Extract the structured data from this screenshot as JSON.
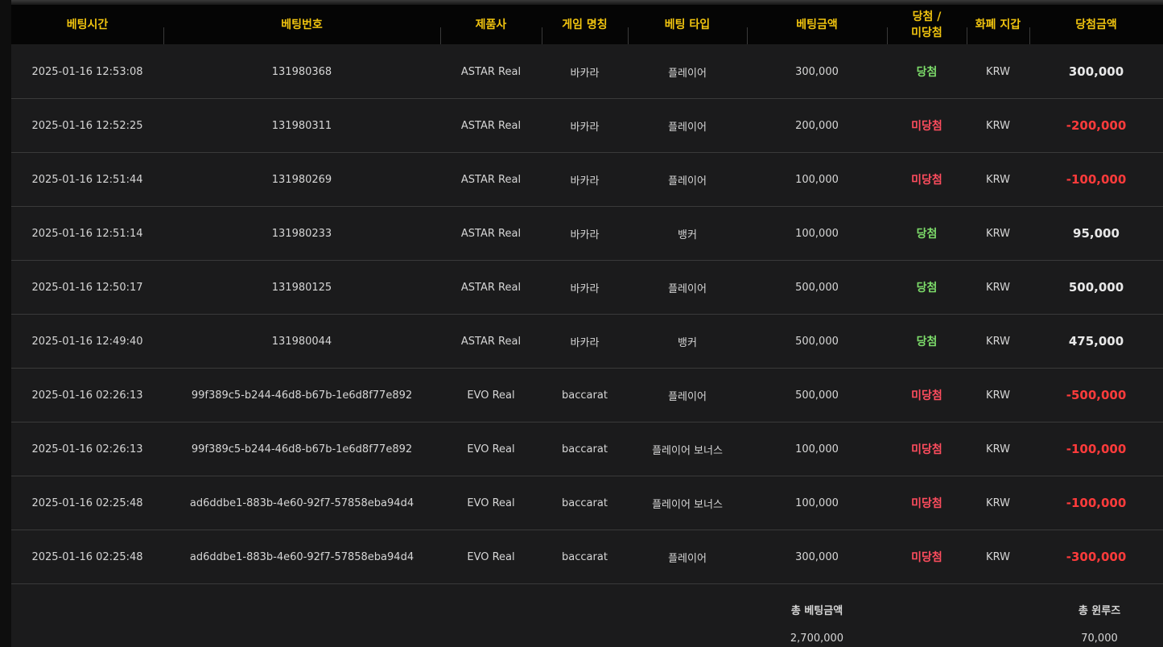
{
  "columns": [
    "베팅시간",
    "베팅번호",
    "제품사",
    "게임 명칭",
    "베팅 타입",
    "베팅금액",
    "당첨 /\n미당첨",
    "화폐 지갑",
    "당첨금액"
  ],
  "column_lines": {
    "win_loss_line1": "당첨 /",
    "win_loss_line2": "미당첨"
  },
  "rows": [
    {
      "time": "2025-01-16 12:53:08",
      "bet_id": "131980368",
      "provider": "ASTAR Real",
      "game": "바카라",
      "bet_type": "플레이어",
      "bet_amount": "300,000",
      "result": "당첨",
      "currency": "KRW",
      "payout": "300,000"
    },
    {
      "time": "2025-01-16 12:52:25",
      "bet_id": "131980311",
      "provider": "ASTAR Real",
      "game": "바카라",
      "bet_type": "플레이어",
      "bet_amount": "200,000",
      "result": "미당첨",
      "currency": "KRW",
      "payout": "-200,000"
    },
    {
      "time": "2025-01-16 12:51:44",
      "bet_id": "131980269",
      "provider": "ASTAR Real",
      "game": "바카라",
      "bet_type": "플레이어",
      "bet_amount": "100,000",
      "result": "미당첨",
      "currency": "KRW",
      "payout": "-100,000"
    },
    {
      "time": "2025-01-16 12:51:14",
      "bet_id": "131980233",
      "provider": "ASTAR Real",
      "game": "바카라",
      "bet_type": "뱅커",
      "bet_amount": "100,000",
      "result": "당첨",
      "currency": "KRW",
      "payout": "95,000"
    },
    {
      "time": "2025-01-16 12:50:17",
      "bet_id": "131980125",
      "provider": "ASTAR Real",
      "game": "바카라",
      "bet_type": "플레이어",
      "bet_amount": "500,000",
      "result": "당첨",
      "currency": "KRW",
      "payout": "500,000"
    },
    {
      "time": "2025-01-16 12:49:40",
      "bet_id": "131980044",
      "provider": "ASTAR Real",
      "game": "바카라",
      "bet_type": "뱅커",
      "bet_amount": "500,000",
      "result": "당첨",
      "currency": "KRW",
      "payout": "475,000"
    },
    {
      "time": "2025-01-16 02:26:13",
      "bet_id": "99f389c5-b244-46d8-b67b-1e6d8f77e892",
      "provider": "EVO Real",
      "game": "baccarat",
      "bet_type": "플레이어",
      "bet_amount": "500,000",
      "result": "미당첨",
      "currency": "KRW",
      "payout": "-500,000"
    },
    {
      "time": "2025-01-16 02:26:13",
      "bet_id": "99f389c5-b244-46d8-b67b-1e6d8f77e892",
      "provider": "EVO Real",
      "game": "baccarat",
      "bet_type": "플레이어 보너스",
      "bet_amount": "100,000",
      "result": "미당첨",
      "currency": "KRW",
      "payout": "-100,000"
    },
    {
      "time": "2025-01-16 02:25:48",
      "bet_id": "ad6ddbe1-883b-4e60-92f7-57858eba94d4",
      "provider": "EVO Real",
      "game": "baccarat",
      "bet_type": "플레이어 보너스",
      "bet_amount": "100,000",
      "result": "미당첨",
      "currency": "KRW",
      "payout": "-100,000"
    },
    {
      "time": "2025-01-16 02:25:48",
      "bet_id": "ad6ddbe1-883b-4e60-92f7-57858eba94d4",
      "provider": "EVO Real",
      "game": "baccarat",
      "bet_type": "플레이어",
      "bet_amount": "300,000",
      "result": "미당첨",
      "currency": "KRW",
      "payout": "-300,000"
    }
  ],
  "summary": {
    "total_bet_label": "총 베팅금액",
    "total_bet_value": "2,700,000",
    "total_winloss_label": "총 윈루즈",
    "total_winloss_value": "70,000"
  },
  "colors": {
    "header_text": "#f1c40f",
    "win": "#7ddc6a",
    "lose": "#ff4d5e",
    "negative_amount": "#ff3b3b"
  }
}
